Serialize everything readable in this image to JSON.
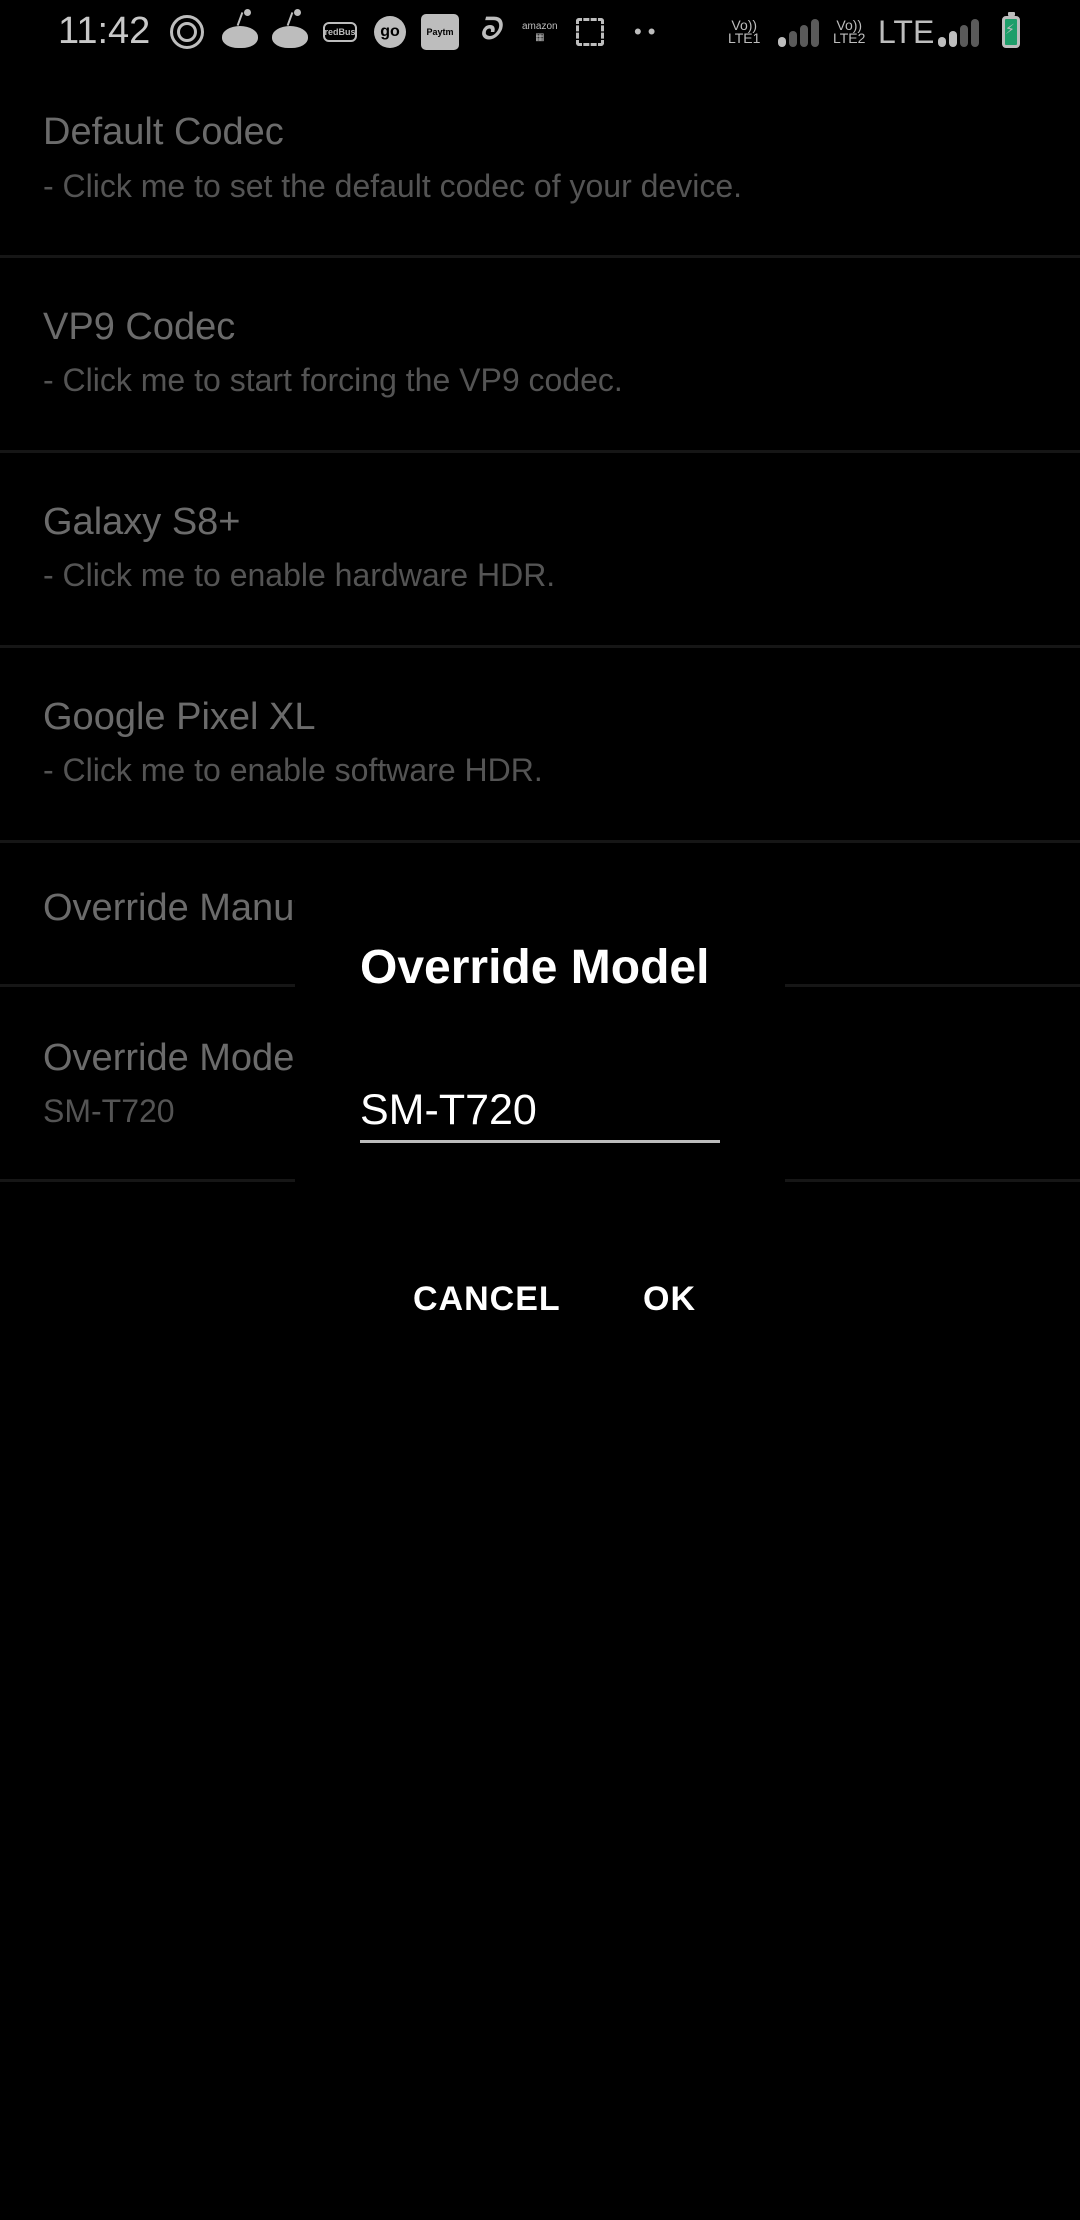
{
  "status_bar": {
    "time": "11:42",
    "notification_icons": [
      "circle-app-icon",
      "reddit-icon",
      "reddit-icon",
      "redbus-icon",
      "go-icon",
      "paytm-icon",
      "airtel-icon",
      "amazon-icon",
      "screenshot-icon",
      "more-dots-icon"
    ],
    "redbus_label": "redBus",
    "go_label": "go",
    "paytm_label": "Paytm",
    "amazon_label": "amazon",
    "more_dots": "••",
    "sim1": {
      "volte": "Vo))",
      "label": "LTE1",
      "signal_bars": 1,
      "signal_max": 4
    },
    "sim2": {
      "volte": "Vo))",
      "label": "LTE2",
      "network": "LTE",
      "signal_bars": 2,
      "signal_max": 4
    },
    "battery": {
      "charging": true,
      "color": "#1e9e6a"
    }
  },
  "settings_list": [
    {
      "title": "Default Codec",
      "subtitle": "- Click me to set the default codec of your device."
    },
    {
      "title": "VP9 Codec",
      "subtitle": "- Click me to start forcing the VP9 codec."
    },
    {
      "title": "Galaxy S8+",
      "subtitle": "- Click me to enable hardware HDR."
    },
    {
      "title": "Google Pixel XL",
      "subtitle": "- Click me to enable software HDR."
    },
    {
      "title": "Override Manufacturer",
      "subtitle": ""
    },
    {
      "title": "Override Model",
      "subtitle": "SM-T720"
    }
  ],
  "dialog": {
    "title": "Override Model",
    "input_value": "SM-T720",
    "cancel_label": "CANCEL",
    "ok_label": "OK"
  }
}
